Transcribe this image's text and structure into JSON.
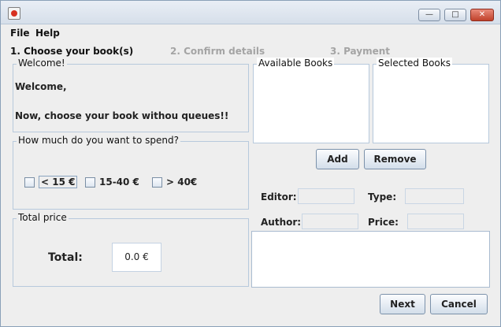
{
  "window": {
    "controls": {
      "minimize": "—",
      "maximize": "□",
      "close": "✕"
    }
  },
  "menu": {
    "items": [
      "File",
      "Help"
    ]
  },
  "steps": [
    "1. Choose your book(s)",
    "2. Confirm details",
    "3. Payment"
  ],
  "welcome": {
    "title": "Welcome!",
    "line1": "Welcome,",
    "line2": "Now, choose your book withou queues!!"
  },
  "budget": {
    "title": "How much do you want to spend?",
    "options": [
      "< 15 €",
      "15-40 €",
      "> 40€"
    ]
  },
  "total": {
    "title": "Total price",
    "label": "Total:",
    "value": "0.0 €"
  },
  "books": {
    "available_title": "Available Books",
    "selected_title": "Selected Books",
    "add_label": "Add",
    "remove_label": "Remove"
  },
  "details": {
    "editor_label": "Editor:",
    "type_label": "Type:",
    "author_label": "Author:",
    "price_label": "Price:"
  },
  "nav": {
    "next_label": "Next",
    "cancel_label": "Cancel"
  },
  "colors": {
    "window_bg": "#eeeeee",
    "group_border": "#b7c9dc",
    "inactive_step": "#a4a4a4"
  }
}
